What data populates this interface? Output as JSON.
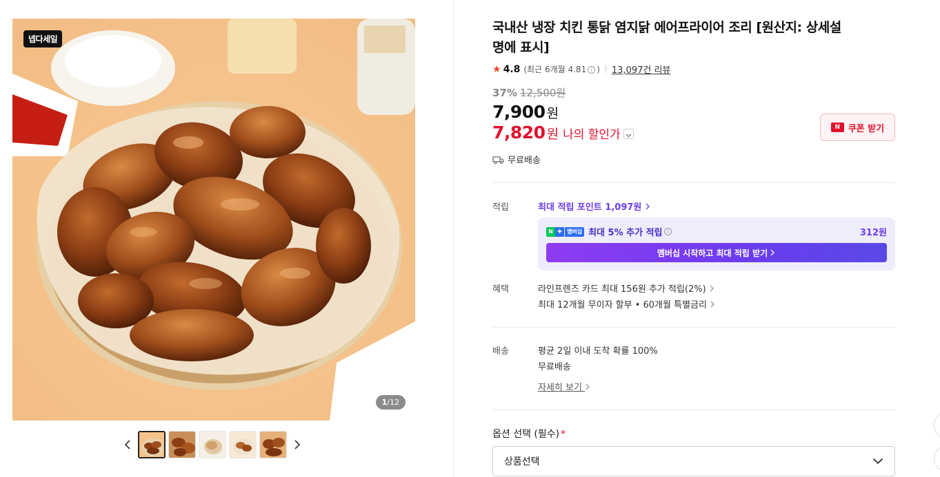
{
  "gallery": {
    "badge": "넵다세일",
    "counter_current": "1",
    "counter_total": "/12",
    "thumbnail_count": 5,
    "active_thumbnail": 1
  },
  "product": {
    "title": "국내산 냉장 치킨 통닭 염지닭 에어프라이어 조리 [원산지: 상세설명에 표시]",
    "rating": "4.8",
    "recent_rating_label": "(최근 6개월 4.81",
    "recent_rating_close": ")",
    "review_count": "13,097건 리뷰",
    "discount_rate": "37%",
    "original_price": "12,500원",
    "sale_price": "7,900",
    "sale_price_unit": "원",
    "my_price": "7,820",
    "my_price_unit": "원",
    "my_price_label": "나의 할인가",
    "coupon_label": "쿠폰 받기",
    "shipping": "무료배송"
  },
  "points": {
    "label": "적립",
    "max_points_text": "최대 적립 포인트",
    "max_points_value": "1,097원",
    "membership_badge": "멤버십",
    "extra_text": "최대 5% 추가 적립",
    "extra_amount": "312원",
    "cta": "멤버십 시작하고 최대 적립 받기"
  },
  "benefits": {
    "label": "혜택",
    "lines": [
      "라인프렌즈 카드 최대 156원 추가 적립(2%)",
      "최대 12개월 무이자 할부 • 60개월 특별금리"
    ]
  },
  "delivery": {
    "label": "배송",
    "lines": [
      "평균 2일 이내 도착 확률 100%",
      "무료배송"
    ],
    "detail_link": "자세히 보기"
  },
  "options": {
    "label": "옵션 선택 (필수)",
    "required_mark": "*",
    "select_value": "상품선택"
  },
  "colors": {
    "accent_red": "#e1112e",
    "accent_purple": "#6b3de8",
    "star": "#ef4423"
  }
}
